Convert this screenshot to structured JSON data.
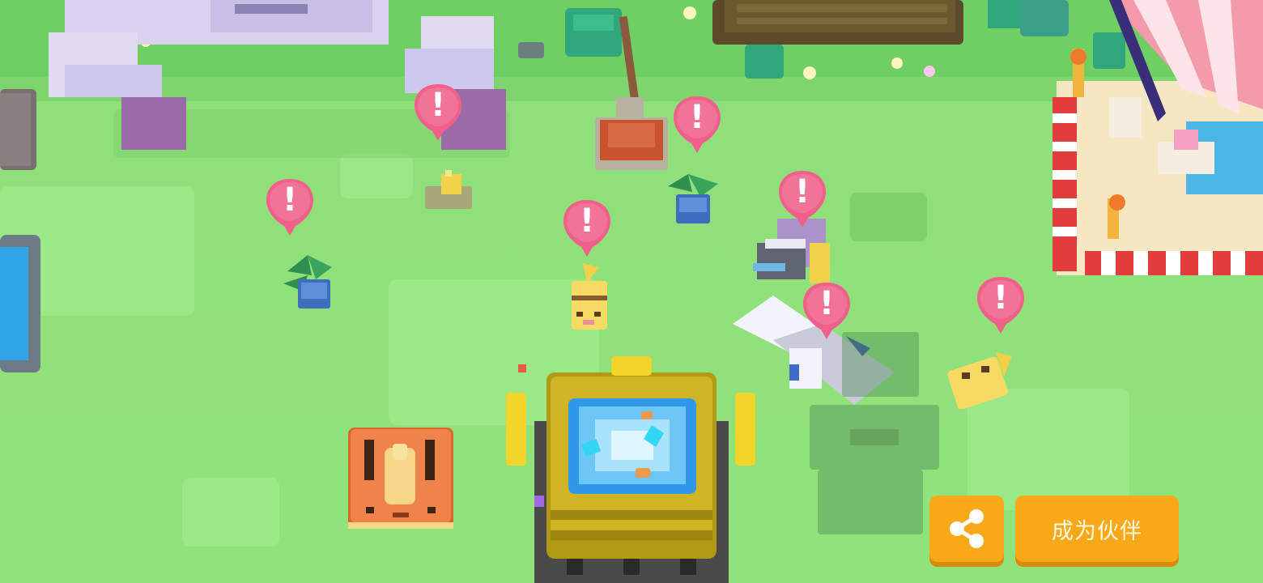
{
  "scene": {
    "alerts": [
      {
        "name": "alert-marker-1",
        "symbol": "!"
      },
      {
        "name": "alert-marker-2",
        "symbol": "!"
      },
      {
        "name": "alert-marker-3",
        "symbol": "!"
      },
      {
        "name": "alert-marker-4",
        "symbol": "!"
      },
      {
        "name": "alert-marker-5",
        "symbol": "!"
      },
      {
        "name": "alert-marker-6",
        "symbol": "!"
      },
      {
        "name": "alert-marker-7",
        "symbol": "!"
      }
    ]
  },
  "controls": {
    "share_icon": "share-icon",
    "partner_label": "成为伙伴"
  },
  "colors": {
    "grass": "#8fe07a",
    "alert": "#f0608a",
    "button": "#f9a817",
    "button_shadow": "#d98a0c"
  }
}
